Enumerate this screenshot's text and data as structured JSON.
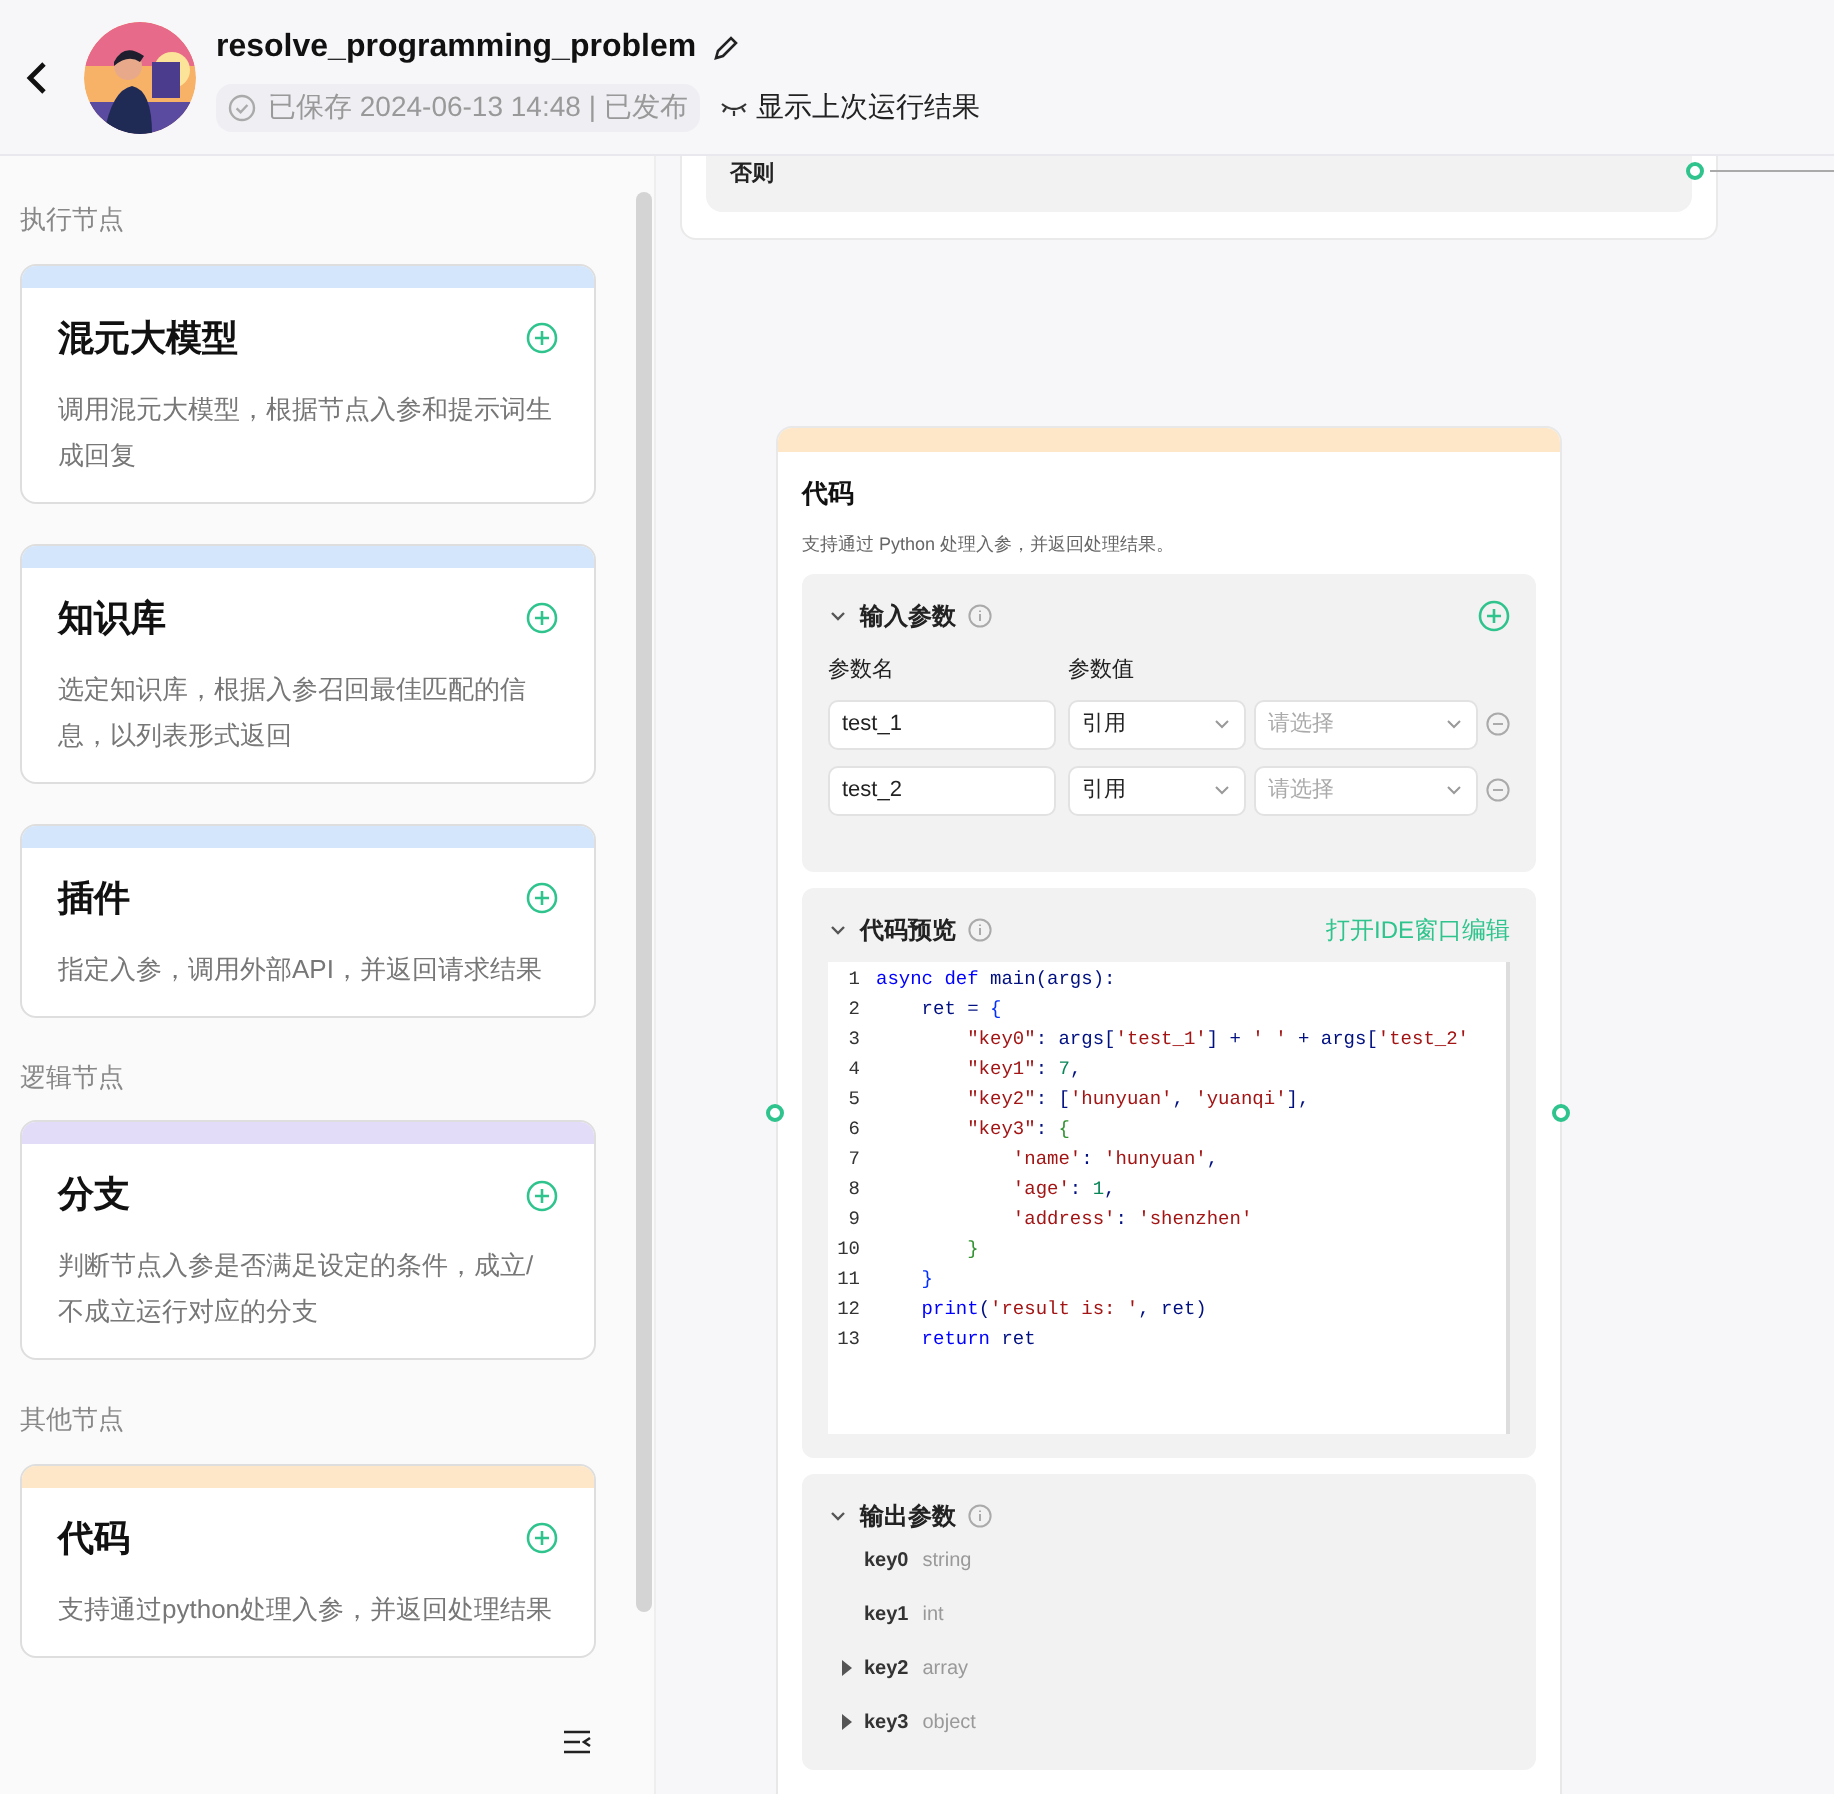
{
  "header": {
    "title": "resolve_programming_problem",
    "status": "已保存 2024-06-13 14:48 | 已发布",
    "toggle_label": "显示上次运行结果"
  },
  "sidebar": {
    "sections": [
      {
        "title": "执行节点",
        "cards": [
          {
            "title": "混元大模型",
            "description": "调用混元大模型，根据节点入参和提示词生成回复",
            "color": "#d3e6fb"
          },
          {
            "title": "知识库",
            "description": "选定知识库，根据入参召回最佳匹配的信息，以列表形式返回",
            "color": "#d3e6fb"
          },
          {
            "title": "插件",
            "description": "指定入参，调用外部API，并返回请求结果",
            "color": "#d3e6fb"
          }
        ]
      },
      {
        "title": "逻辑节点",
        "cards": [
          {
            "title": "分支",
            "description": "判断节点入参是否满足设定的条件，成立/不成立运行对应的分支",
            "color": "#e3dcf8"
          }
        ]
      },
      {
        "title": "其他节点",
        "cards": [
          {
            "title": "代码",
            "description": "支持通过python处理入参，并返回处理结果",
            "color": "#fde7c8"
          }
        ]
      }
    ]
  },
  "canvas": {
    "branch_node": {
      "else_label": "否则"
    },
    "code_node": {
      "title": "代码",
      "subtitle": "支持通过 Python 处理入参，并返回处理结果。",
      "inputs": {
        "title": "输入参数",
        "name_header": "参数名",
        "value_header": "参数值",
        "rows": [
          {
            "name": "test_1",
            "source": "引用",
            "placeholder": "请选择"
          },
          {
            "name": "test_2",
            "source": "引用",
            "placeholder": "请选择"
          }
        ]
      },
      "preview": {
        "title": "代码预览",
        "open_ide": "打开IDE窗口编辑",
        "lines": [
          {
            "number": "1",
            "tokens": [
              {
                "kind": "kw",
                "text": "async def"
              },
              {
                "kind": "txt",
                "text": " main(args):"
              }
            ]
          },
          {
            "number": "2",
            "tokens": [
              {
                "kind": "txt",
                "text": "    ret = "
              },
              {
                "kind": "b1",
                "text": "{"
              }
            ]
          },
          {
            "number": "3",
            "tokens": [
              {
                "kind": "str",
                "text": "        \"key0\""
              },
              {
                "kind": "txt",
                "text": ": args["
              },
              {
                "kind": "str",
                "text": "'test_1'"
              },
              {
                "kind": "txt",
                "text": "] + "
              },
              {
                "kind": "str",
                "text": "' '"
              },
              {
                "kind": "txt",
                "text": " + args["
              },
              {
                "kind": "str",
                "text": "'test_2'"
              }
            ]
          },
          {
            "number": "4",
            "tokens": [
              {
                "kind": "str",
                "text": "        \"key1\""
              },
              {
                "kind": "txt",
                "text": ": "
              },
              {
                "kind": "num",
                "text": "7"
              },
              {
                "kind": "txt",
                "text": ","
              }
            ]
          },
          {
            "number": "5",
            "tokens": [
              {
                "kind": "str",
                "text": "        \"key2\""
              },
              {
                "kind": "txt",
                "text": ": ["
              },
              {
                "kind": "str",
                "text": "'hunyuan'"
              },
              {
                "kind": "txt",
                "text": ", "
              },
              {
                "kind": "str",
                "text": "'yuanqi'"
              },
              {
                "kind": "txt",
                "text": "],"
              }
            ]
          },
          {
            "number": "6",
            "tokens": [
              {
                "kind": "str",
                "text": "        \"key3\""
              },
              {
                "kind": "txt",
                "text": ": "
              },
              {
                "kind": "b2",
                "text": "{"
              }
            ]
          },
          {
            "number": "7",
            "tokens": [
              {
                "kind": "str",
                "text": "            'name'"
              },
              {
                "kind": "txt",
                "text": ": "
              },
              {
                "kind": "str",
                "text": "'hunyuan'"
              },
              {
                "kind": "txt",
                "text": ","
              }
            ]
          },
          {
            "number": "8",
            "tokens": [
              {
                "kind": "str",
                "text": "            'age'"
              },
              {
                "kind": "txt",
                "text": ": "
              },
              {
                "kind": "num",
                "text": "1"
              },
              {
                "kind": "txt",
                "text": ","
              }
            ]
          },
          {
            "number": "9",
            "tokens": [
              {
                "kind": "str",
                "text": "            'address'"
              },
              {
                "kind": "txt",
                "text": ": "
              },
              {
                "kind": "str",
                "text": "'shenzhen'"
              }
            ]
          },
          {
            "number": "10",
            "tokens": [
              {
                "kind": "b2",
                "text": "        }"
              }
            ]
          },
          {
            "number": "11",
            "tokens": [
              {
                "kind": "b1",
                "text": "    }"
              }
            ]
          },
          {
            "number": "12",
            "tokens": [
              {
                "kind": "kw",
                "text": "    print"
              },
              {
                "kind": "txt",
                "text": "("
              },
              {
                "kind": "str",
                "text": "'result is: '"
              },
              {
                "kind": "txt",
                "text": ", ret)"
              }
            ]
          },
          {
            "number": "13",
            "tokens": [
              {
                "kind": "kw",
                "text": "    return"
              },
              {
                "kind": "txt",
                "text": " ret"
              }
            ]
          }
        ]
      },
      "outputs": {
        "title": "输出参数",
        "rows": [
          {
            "name": "key0",
            "type": "string",
            "kind": "scalar"
          },
          {
            "name": "key1",
            "type": "int",
            "kind": "scalar"
          },
          {
            "name": "key2",
            "type": "array",
            "kind": "nested"
          },
          {
            "name": "key3",
            "type": "object",
            "kind": "nested"
          }
        ]
      }
    }
  }
}
